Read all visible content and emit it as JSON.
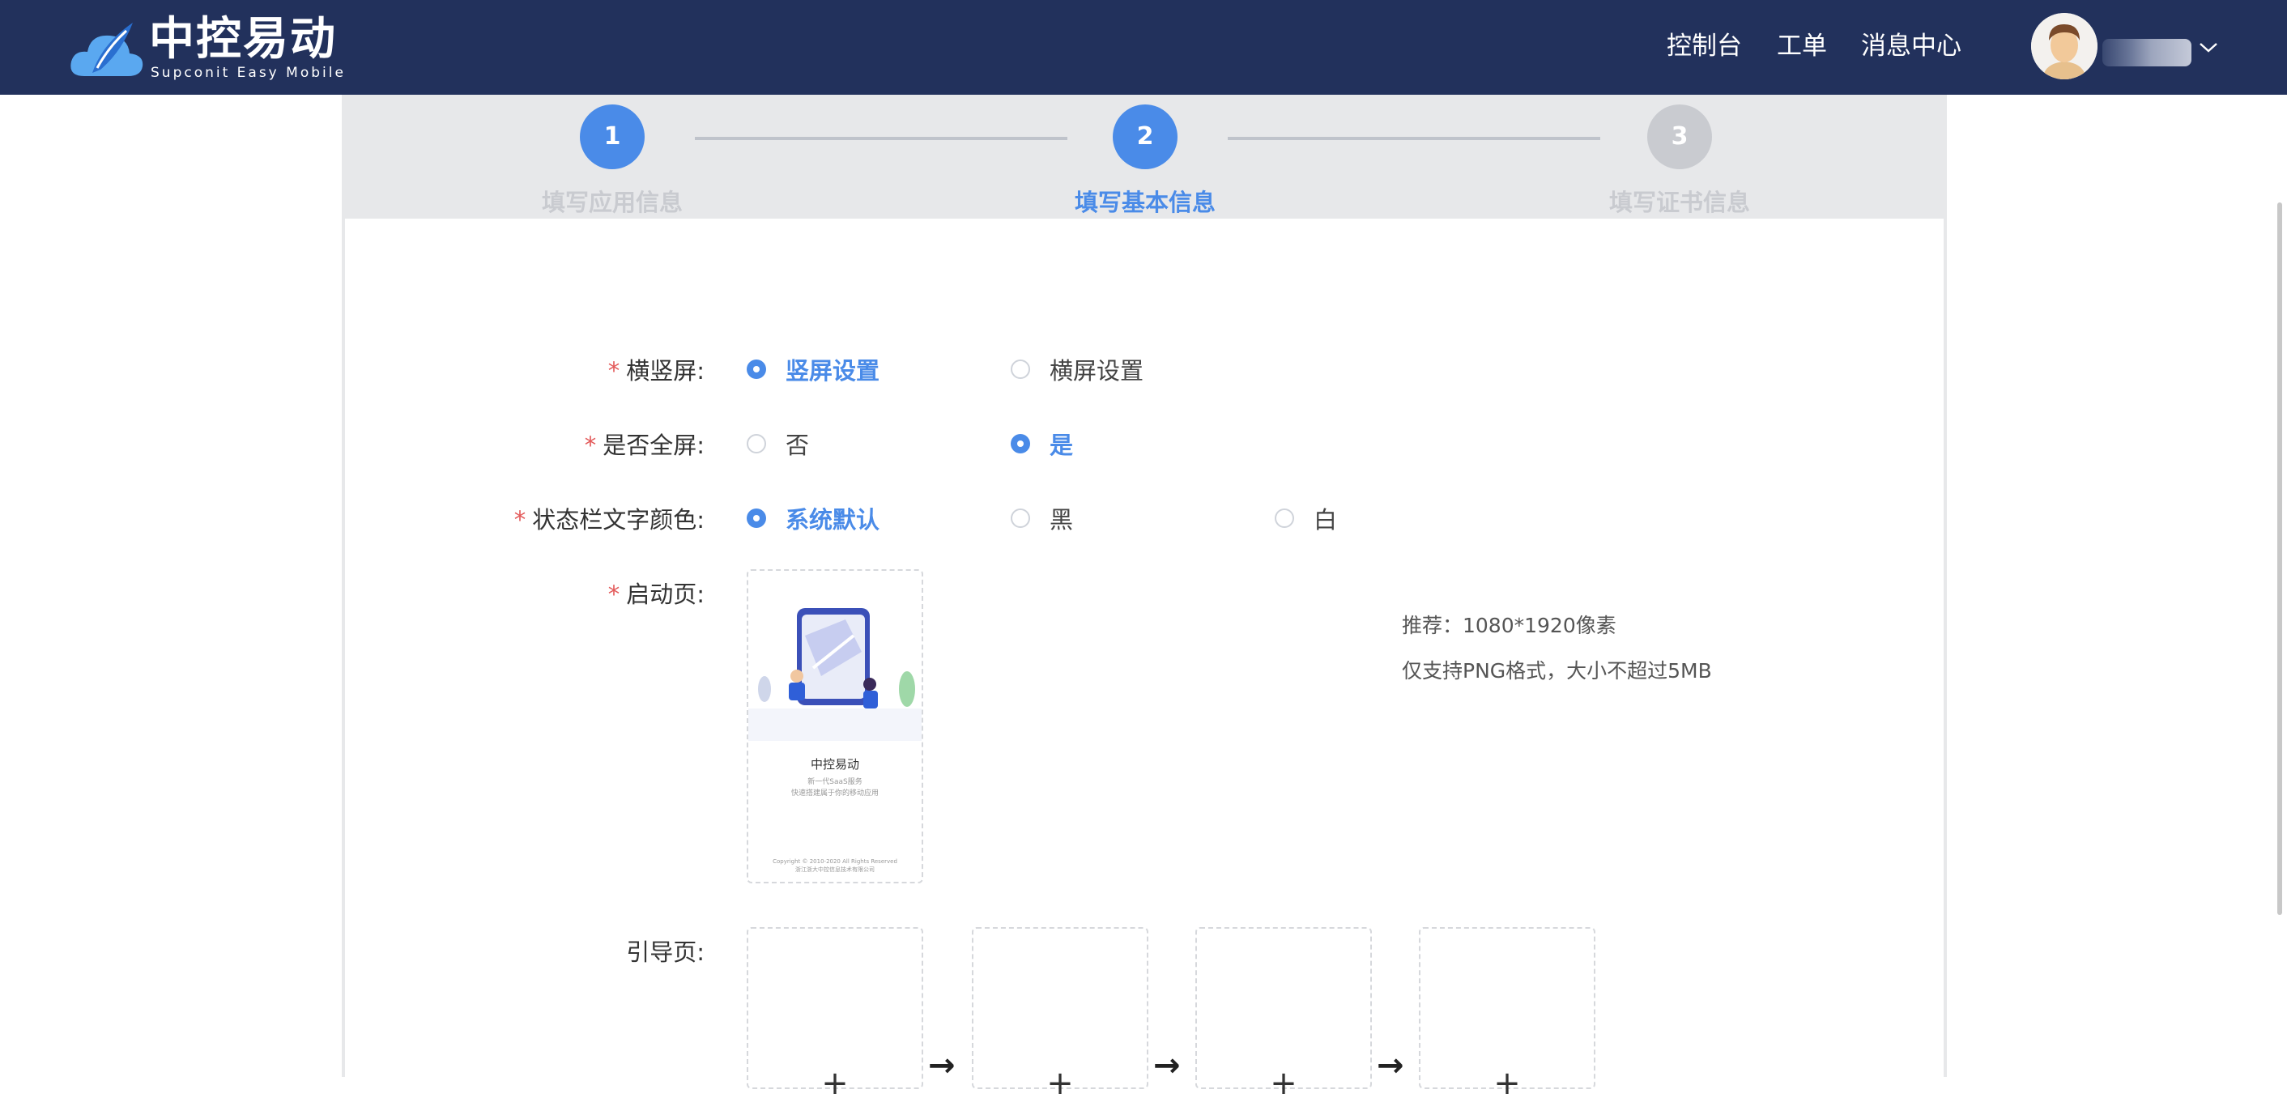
{
  "header": {
    "logo_title": "中控易动",
    "logo_subtitle": "Supconit Easy Mobile",
    "nav": [
      "控制台",
      "工单",
      "消息中心"
    ]
  },
  "steps": [
    {
      "number": "1",
      "label": "填写应用信息",
      "state": "done"
    },
    {
      "number": "2",
      "label": "填写基本信息",
      "state": "active"
    },
    {
      "number": "3",
      "label": "填写证书信息",
      "state": "pending"
    }
  ],
  "form": {
    "orientation": {
      "label": "横竖屏:",
      "required": "*",
      "options": [
        {
          "text": "竖屏设置",
          "checked": true
        },
        {
          "text": "横屏设置",
          "checked": false
        }
      ]
    },
    "fullscreen": {
      "label": "是否全屏:",
      "required": "*",
      "options": [
        {
          "text": "否",
          "checked": false
        },
        {
          "text": "是",
          "checked": true
        }
      ]
    },
    "statusbar": {
      "label": "状态栏文字颜色:",
      "required": "*",
      "options": [
        {
          "text": "系统默认",
          "checked": true
        },
        {
          "text": "黑",
          "checked": false
        },
        {
          "text": "白",
          "checked": false
        }
      ]
    },
    "splash": {
      "label": "启动页:",
      "required": "*",
      "preview": {
        "title": "中控易动",
        "line1": "新一代SaaS服务",
        "line2": "快速搭建属于你的移动应用",
        "footer1": "Copyright © 2010-2020 All Rights Reserved",
        "footer2": "浙江浙大中控信息技术有限公司"
      },
      "hint_size": "推荐：1080*1920像素",
      "hint_format": "仅支持PNG格式，大小不超过5MB"
    },
    "guide": {
      "label": "引导页:",
      "plus": "+",
      "arrow": "→",
      "slots": 4
    }
  },
  "colors": {
    "header_bg": "#22315c",
    "accent": "#4a8be8",
    "pending": "#c9cbd0",
    "required": "#e35a5a"
  }
}
